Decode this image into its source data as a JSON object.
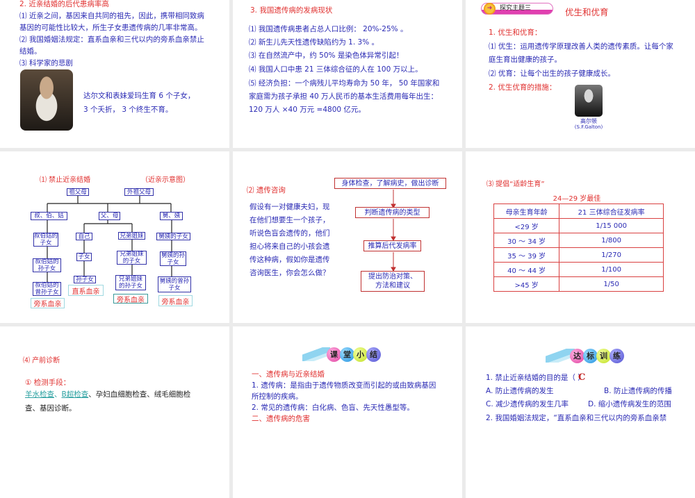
{
  "slides": {
    "s1": {
      "title": "2. 近亲结婚的后代患病率高",
      "lines": [
        "⑴ 近亲之间，基因来自共同的祖先，因此，携带相同致病",
        "基因的可能性比较大，所生子女患遗传病的几率非常高。",
        "⑵ 我国婚姻法规定：直系血亲和三代以内的旁系血亲禁止",
        "结婚。",
        "⑶ 科学家的悲剧"
      ],
      "caption": [
        "达尔文和表妹爱玛生育 6 个子女，",
        "3 个夭折， 3 个终生不育。"
      ]
    },
    "s2": {
      "title": "3. 我国遗传病的发病现状",
      "lines": [
        "⑴ 我国遗传病患者占总人口比例： 20%-25% 。",
        "⑵ 新生儿先天性遗传缺陷约为 1. 3% 。",
        "⑶ 在自然流产中，约 50% 是染色体异常引起！",
        "⑷ 我国人口中患 21 三体综合征的人在 100 万以上。",
        "⑸ 经济负担：一个病残儿平均寿命为 50 年， 50 年国家和",
        "家庭需为孩子承担 40 万人民币的基本生活费用每年出生：",
        "120 万人 ×40 万元 =4800 亿元。"
      ]
    },
    "s3": {
      "badge": "探究主题三",
      "title": "优生和优育",
      "lines": [
        "1. 优生和优育：",
        "⑴ 优生：运用遗传学原理改善人类的遗传素质。让每个家",
        "庭生育出健康的孩子。",
        "⑵ 优育：让每个出生的孩子健康成长。",
        "2. 优生优育的措施："
      ],
      "photo_name": "高尔顿",
      "photo_en": "(S.F.Galton)"
    },
    "s4": {
      "title": "⑴ 禁止近亲结婚",
      "subtitle": "（近亲示意图）",
      "nodes": {
        "gf": "祖父母",
        "wgf": "外祖父母",
        "uncle": "叔、伯、姑",
        "parents": "父、母",
        "jiu": "舅、姨",
        "self": "自己",
        "sib": "兄弟姐妹",
        "u1": "叔伯姑的子女",
        "u2": "叔伯姑的孙子女",
        "u3": "叔伯姑的曾孙子女",
        "c1": "子女",
        "c2": "孙子女",
        "s1": "兄弟姐妹的子女",
        "s2": "兄弟姐妹的孙子女",
        "j1": "舅姨的子女",
        "j2": "舅姨的孙子女",
        "j3": "舅姨的曾孙子女"
      },
      "kin": {
        "collateral": "旁系血亲",
        "direct": "直系血亲"
      }
    },
    "s5": {
      "title": "⑵ 遗传咨询",
      "para": [
        "假设有一对健康夫妇，现",
        "在他们想要生一个孩子，",
        "听说色盲会遗传的，他们",
        "担心将来自己的小孩会遗",
        "传这种病，假如你是遗传",
        "咨询医生，你会怎么做？"
      ],
      "flow": [
        "身体检查，了解病史，做出诊断",
        "判断遗传病的类型",
        "推算后代发病率",
        "提出防治对策、方法和建议"
      ]
    },
    "s6": {
      "title": "⑶ 提倡“适龄生育”",
      "subtitle": "24—29 岁最佳",
      "headers": [
        "母亲生育年龄",
        "21 三体综合征发病率"
      ],
      "rows": [
        [
          "<29 岁",
          "1/15 000"
        ],
        [
          "30 ～ 34 岁",
          "1/800"
        ],
        [
          "35 ～ 39 岁",
          "1/270"
        ],
        [
          "40 ～ 44 岁",
          "1/100"
        ],
        [
          ">45 岁",
          "1/50"
        ]
      ]
    },
    "s7": {
      "title": "⑷ 产前诊断",
      "sub": "① 检测手段：",
      "link1": "羊水检查",
      "link2": "B超检查",
      "rest": "、孕妇血细胞检查、绒毛细胞检",
      "line2": "查、基因诊断。"
    },
    "s8": {
      "banner": [
        "课",
        "堂",
        "小",
        "结"
      ],
      "h1": "一、遗传病与近亲结婚",
      "lines": [
        "1. 遗传病：是指由于遗传物质改变而引起的或由致病基因",
        "所控制的疾病。",
        "2. 常见的遗传病：白化病、色盲、先天性愚型等。"
      ],
      "h2": "二、遗传病的危害"
    },
    "s9": {
      "banner": [
        "达",
        "标",
        "训",
        "练"
      ],
      "q1": "1. 禁止近亲结婚的目的是（        ）",
      "answer": "C",
      "a": "A. 防止遗传病的发生",
      "b": "B. 防止遗传病的传播",
      "c": "C. 减少遗传病的发生几率",
      "d": "D. 缩小遗传病发生的范围",
      "q2": "2. 我国婚姻法规定，“直系血亲和三代以内的旁系血亲禁"
    }
  },
  "colors": {
    "blue": "#2a2ab4",
    "red": "#e0302f"
  }
}
